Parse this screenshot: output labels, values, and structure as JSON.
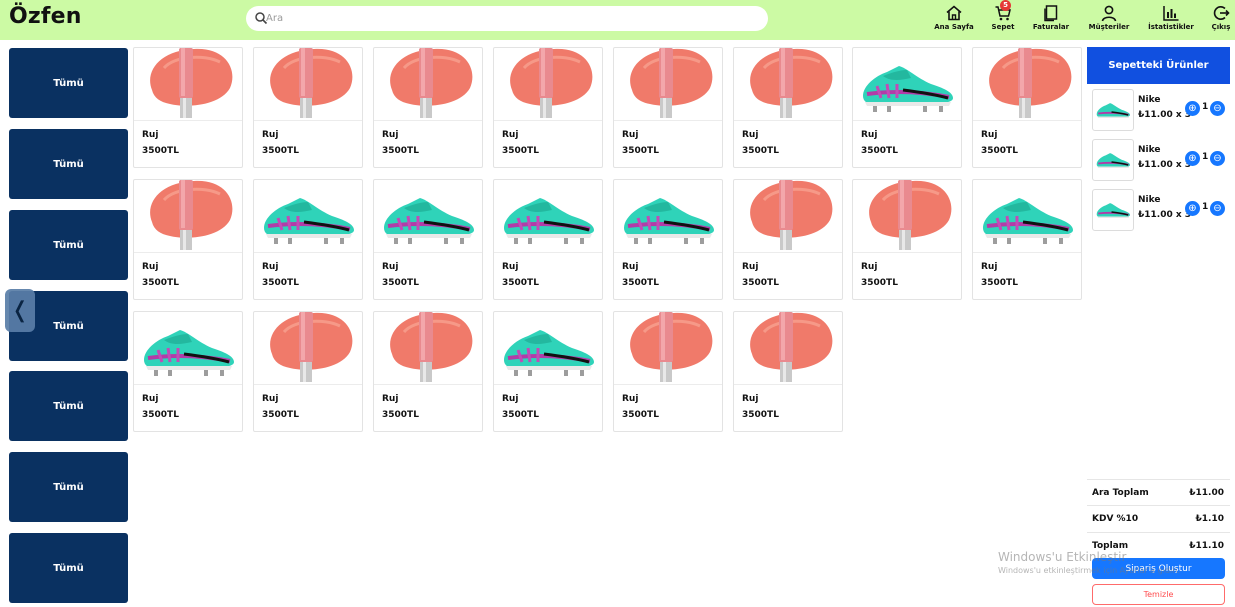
{
  "app": {
    "logo": "Özfen"
  },
  "search": {
    "placeholder": "Ara"
  },
  "nav": [
    {
      "label": "Ana Sayfa",
      "icon": "home-icon"
    },
    {
      "label": "Sepet",
      "icon": "cart-icon",
      "badge": "5"
    },
    {
      "label": "Faturalar",
      "icon": "invoice-icon"
    },
    {
      "label": "Müşteriler",
      "icon": "user-icon"
    },
    {
      "label": "İstatistikler",
      "icon": "chart-icon"
    },
    {
      "label": "Çıkış",
      "icon": "logout-icon"
    }
  ],
  "categories": [
    "Tümü",
    "Tümü",
    "Tümü",
    "Tümü",
    "Tümü",
    "Tümü",
    "Tümü"
  ],
  "sidebar_toggle": {
    "glyph": "❬",
    "icon": "chevron-left-icon"
  },
  "products": [
    {
      "name": "Ruj",
      "price": "3500TL",
      "image": "lipstick"
    },
    {
      "name": "Ruj",
      "price": "3500TL",
      "image": "lipstick"
    },
    {
      "name": "Ruj",
      "price": "3500TL",
      "image": "lipstick"
    },
    {
      "name": "Ruj",
      "price": "3500TL",
      "image": "lipstick"
    },
    {
      "name": "Ruj",
      "price": "3500TL",
      "image": "lipstick"
    },
    {
      "name": "Ruj",
      "price": "3500TL",
      "image": "lipstick"
    },
    {
      "name": "Ruj",
      "price": "3500TL",
      "image": "shoe"
    },
    {
      "name": "Ruj",
      "price": "3500TL",
      "image": "lipstick"
    },
    {
      "name": "Ruj",
      "price": "3500TL",
      "image": "lipstick"
    },
    {
      "name": "Ruj",
      "price": "3500TL",
      "image": "shoe"
    },
    {
      "name": "Ruj",
      "price": "3500TL",
      "image": "shoe"
    },
    {
      "name": "Ruj",
      "price": "3500TL",
      "image": "shoe"
    },
    {
      "name": "Ruj",
      "price": "3500TL",
      "image": "shoe"
    },
    {
      "name": "Ruj",
      "price": "3500TL",
      "image": "lipstick"
    },
    {
      "name": "Ruj",
      "price": "3500TL",
      "image": "lipstick"
    },
    {
      "name": "Ruj",
      "price": "3500TL",
      "image": "shoe"
    },
    {
      "name": "Ruj",
      "price": "3500TL",
      "image": "shoe"
    },
    {
      "name": "Ruj",
      "price": "3500TL",
      "image": "lipstick"
    },
    {
      "name": "Ruj",
      "price": "3500TL",
      "image": "lipstick"
    },
    {
      "name": "Ruj",
      "price": "3500TL",
      "image": "shoe"
    },
    {
      "name": "Ruj",
      "price": "3500TL",
      "image": "lipstick"
    },
    {
      "name": "Ruj",
      "price": "3500TL",
      "image": "lipstick"
    }
  ],
  "cart": {
    "title": "Sepetteki Ürünler",
    "items": [
      {
        "name": "Nike",
        "price": "₺11.00 x 3",
        "qty": "1",
        "image": "shoe"
      },
      {
        "name": "Nike",
        "price": "₺11.00 x 3",
        "qty": "1",
        "image": "shoe"
      },
      {
        "name": "Nike",
        "price": "₺11.00 x 3",
        "qty": "1",
        "image": "shoe"
      }
    ],
    "summary": {
      "subtotal_label": "Ara Toplam",
      "subtotal_value": "₺11.00",
      "tax_label": "KDV %10",
      "tax_value": "₺1.10",
      "total_label": "Toplam",
      "total_value": "₺11.10"
    },
    "order_button": "Sipariş Oluştur",
    "clear_button": "Temizle"
  },
  "watermark": {
    "line1": "Windows'u Etkinleştir",
    "line2": "Windows'u etkinleştirmek için Ayarlar'a gidin."
  },
  "colors": {
    "header_bg": "#ccfaa4",
    "category_bg": "#0a3161",
    "cart_header": "#1150e0",
    "accent": "#1677ff",
    "danger": "#ff4d4f"
  }
}
